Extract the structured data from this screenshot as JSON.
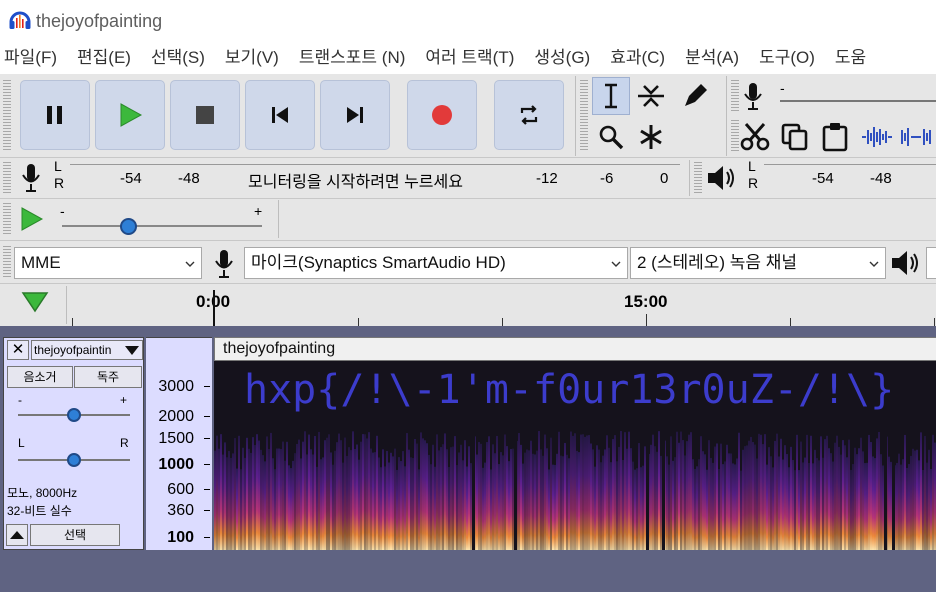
{
  "window": {
    "title": "thejoyofpainting"
  },
  "menu": [
    "파일(F)",
    "편집(E)",
    "선택(S)",
    "보기(V)",
    "트랜스포트 (N)",
    "여러 트랙(T)",
    "생성(G)",
    "효과(C)",
    "분석(A)",
    "도구(O)",
    "도움"
  ],
  "meters": {
    "rec_scale": [
      "-54",
      "-48",
      "-12",
      "-6",
      "0"
    ],
    "rec_hint": "모니터링을 시작하려면 누르세요",
    "play_scale": [
      "-54",
      "-48"
    ],
    "lr": [
      "L",
      "R"
    ]
  },
  "playback": {
    "minus": "-",
    "plus": "+"
  },
  "device": {
    "host": "MME",
    "input": "마이크(Synaptics SmartAudio HD)",
    "channels": "2 (스테레오) 녹음 채널"
  },
  "timeline": {
    "t0": "0:00",
    "t1": "15:00"
  },
  "track": {
    "name": "thejoyofpaintin",
    "mute": "음소거",
    "solo": "독주",
    "gain_minus": "-",
    "gain_plus": "+",
    "pan_l": "L",
    "pan_r": "R",
    "info1": "모노, 8000Hz",
    "info2": "32-비트 실수",
    "select": "선택",
    "clip_name": "thejoyofpainting",
    "ruler": [
      "3000",
      "2000",
      "1500",
      "1000",
      "600",
      "360",
      "100"
    ],
    "hidden_text": "hxp{/!\\-1'm-f0ur13r0uZ-/!\\}"
  },
  "colors": {
    "accent": "#cfd8ea",
    "track_bg": "#5f6382",
    "spectro_text": "#3a3ad0"
  }
}
